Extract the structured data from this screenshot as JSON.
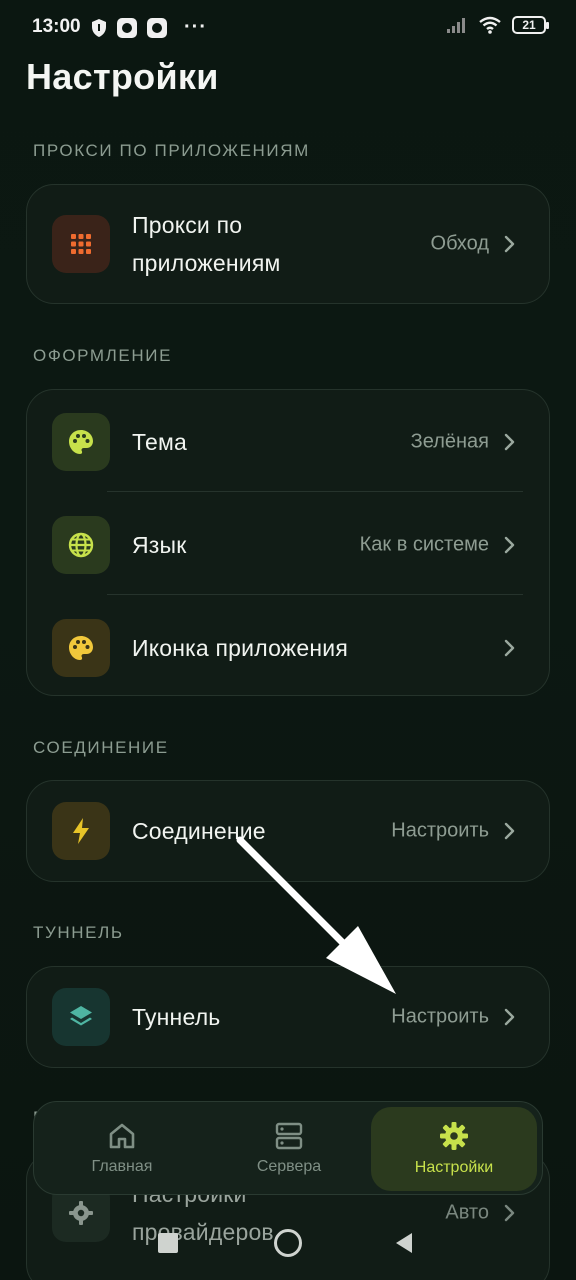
{
  "status_bar": {
    "time": "13:00",
    "dots": "···",
    "battery": "21"
  },
  "page": {
    "title": "Настройки"
  },
  "sections": {
    "per_app": {
      "label": "ПРОКСИ ПО ПРИЛОЖЕНИЯМ",
      "row": {
        "title_line1": "Прокси по",
        "title_line2": "приложениям",
        "value": "Обход"
      }
    },
    "appearance": {
      "label": "ОФОРМЛЕНИЕ",
      "rows": [
        {
          "title": "Тема",
          "value": "Зелёная"
        },
        {
          "title": "Язык",
          "value": "Как в системе"
        },
        {
          "title": "Иконка приложения",
          "value": ""
        }
      ]
    },
    "connection": {
      "label": "СОЕДИНЕНИЕ",
      "row": {
        "title": "Соединение",
        "value": "Настроить"
      }
    },
    "tunnel": {
      "label": "ТУННЕЛЬ",
      "row": {
        "title": "Туннель",
        "value": "Настроить"
      }
    },
    "providers": {
      "label": "П",
      "row": {
        "title_line1": "Настройки",
        "title_line2": "провайдеров",
        "value": "Авто"
      }
    }
  },
  "bottom_nav": {
    "items": [
      {
        "label": "Главная",
        "icon": "home-icon"
      },
      {
        "label": "Сервера",
        "icon": "servers-icon"
      },
      {
        "label": "Настройки",
        "icon": "gear-icon",
        "active": true
      }
    ]
  },
  "colors": {
    "background": "#0b1711",
    "card": "#111c16",
    "accent": "#c7e14b",
    "orange": "#ef6b2f",
    "yellow": "#e7c428",
    "teal": "#4fb5a2"
  }
}
